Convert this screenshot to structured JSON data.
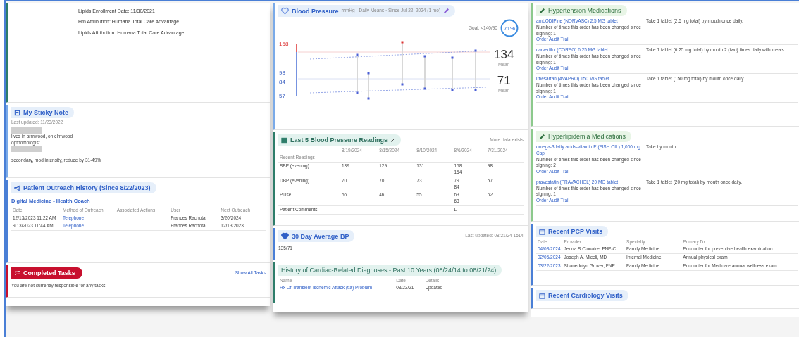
{
  "enrollment_panel": {
    "lines": [
      "Lipids Enrollment Date: 11/30/2021",
      "Htn Attribution: Humana Total Care Advantage",
      "Lipids Attribution: Humana Total Care Advantage"
    ]
  },
  "sticky_note": {
    "title": "My Sticky Note",
    "updated": "Last updated: 11/23/2022",
    "lines": [
      {
        "kind": "redacted"
      },
      {
        "kind": "text",
        "text": "lives in armwood, on elmwood"
      },
      {
        "kind": "text",
        "text": "opthomologist"
      },
      {
        "kind": "redacted"
      },
      {
        "kind": "gap"
      },
      {
        "kind": "text",
        "text": "secondary, mod intensity, reduce by 31-49%"
      }
    ]
  },
  "outreach": {
    "title": "Patient Outreach History (Since 8/22/2023)",
    "program": "Digital Medicine - Health Coach",
    "columns": [
      "Date",
      "Method of Outreach",
      "Associated Actions",
      "User",
      "Next Outreach"
    ],
    "rows": [
      {
        "date": "12/13/2023 11:22 AM",
        "method": "Telephone",
        "user": "Frances Rachota",
        "next": "3/20/2024"
      },
      {
        "date": "9/13/2023 11:44 AM",
        "method": "Telephone",
        "user": "Frances Rachota",
        "next": "12/13/2023"
      }
    ]
  },
  "tasks": {
    "title": "Completed Tasks",
    "link": "Show All Tasks",
    "message": "You are not currently responsible for any tasks."
  },
  "blood_pressure": {
    "title": "Blood Pressure",
    "subtitle": "mmHg · Daily Means · Since Jul 22, 2024 (1 mo)",
    "goal": "Goal: <140/90",
    "goal_ring": {
      "text": "71%"
    },
    "axis_labels": [
      {
        "text": "158",
        "alert": true
      },
      {
        "text": "98",
        "alert": false
      },
      {
        "text": "84",
        "alert": false
      },
      {
        "text": "57",
        "alert": false
      }
    ],
    "means": [
      {
        "value": "134",
        "label": "Mean"
      },
      {
        "value": "71",
        "label": "Mean"
      }
    ]
  },
  "readings": {
    "title": "Last 5 Blood Pressure Readings",
    "note": "More data exists",
    "dates": [
      "8/19/2024",
      "8/15/2024",
      "8/10/2024",
      "8/6/2024",
      "7/31/2024"
    ],
    "section_label": "Recent Readings",
    "rows": [
      {
        "label": "SBP (evening)",
        "values": [
          [
            "139"
          ],
          [
            "129"
          ],
          [
            "131"
          ],
          [
            "158",
            "154"
          ],
          [
            "98"
          ]
        ]
      },
      {
        "label": "DBP (evening)",
        "values": [
          [
            "70"
          ],
          [
            "70"
          ],
          [
            "73"
          ],
          [
            "79",
            "84"
          ],
          [
            "57"
          ]
        ]
      },
      {
        "label": "Pulse",
        "values": [
          [
            "56"
          ],
          [
            "46"
          ],
          [
            "55"
          ],
          [
            "63",
            "63"
          ],
          [
            "62"
          ]
        ]
      },
      {
        "label": "Patient Comments",
        "values": [
          [
            "-"
          ],
          [
            "-"
          ],
          [
            "-"
          ],
          [
            "L"
          ],
          [
            "-"
          ]
        ]
      }
    ]
  },
  "avg_bp": {
    "title": "30 Day Average BP",
    "updated": "Last updated: 08/21/24 1514",
    "value": "135/71"
  },
  "diagnoses": {
    "title": "History of Cardiac-Related Diagnoses - Past 10 Years (08/24/14 to 08/21/24)",
    "columns": [
      "Name",
      "Date",
      "Details"
    ],
    "rows": [
      {
        "name": "Hx Of Transient Ischemic Attack (tia) Problem",
        "date": "03/23/21",
        "details": "Updated"
      }
    ]
  },
  "med_groups": [
    {
      "title": "Hypertension Medications",
      "meds": [
        {
          "name": "amLODIPine (NORVASC) 2.5 MG tablet",
          "sig": "Take 1 tablet (2.5 mg total) by mouth once daily.",
          "changes": "Number of times this order has been changed since signing: 1",
          "audit": "Order Audit Trail"
        },
        {
          "name": "carvedilol (COREG) 6.25 MG tablet",
          "sig": "Take 1 tablet (6.25 mg total) by mouth 2 (two) times daily with meals.",
          "changes": "Number of times this order has been changed since signing: 1",
          "audit": "Order Audit Trail"
        },
        {
          "name": "irbesartan (AVAPRO) 150 MG tablet",
          "sig": "Take 1 tablet (150 mg total) by mouth once daily.",
          "changes": "Number of times this order has been changed since signing: 1",
          "audit": "Order Audit Trail"
        }
      ]
    },
    {
      "title": "Hyperlipidemia Medications",
      "meds": [
        {
          "name": "omega-3 fatty acids-vitamin E (FISH OIL) 1,000 mg Cap",
          "sig": "Take by mouth.",
          "changes": "Number of times this order has been changed since signing: 2",
          "audit": "Order Audit Trail"
        },
        {
          "name": "pravastatin (PRAVACHOL) 20 MG tablet",
          "sig": "Take 1 tablet (20 mg total) by mouth once daily.",
          "changes": "Number of times this order has been changed since signing: 1",
          "audit": "Order Audit Trail"
        }
      ]
    }
  ],
  "pcp_visits": {
    "title": "Recent PCP Visits",
    "columns": [
      "Date",
      "Provider",
      "Specialty",
      "Primary Dx"
    ],
    "rows": [
      {
        "date": "04/03/2024",
        "provider": "Jenna S Clouatre, FNP-C",
        "specialty": "Family Medicine",
        "dx": "Encounter for preventive health examination"
      },
      {
        "date": "02/05/2024",
        "provider": "Joseph A. Miceli, MD",
        "specialty": "Internal Medicine",
        "dx": "Annual physical exam"
      },
      {
        "date": "03/22/2023",
        "provider": "Shanedolyn Grover, FNP",
        "specialty": "Family Medicine",
        "dx": "Encounter for Medicare annual wellness exam"
      }
    ]
  },
  "cardiology_visits": {
    "title": "Recent Cardiology Visits"
  }
}
